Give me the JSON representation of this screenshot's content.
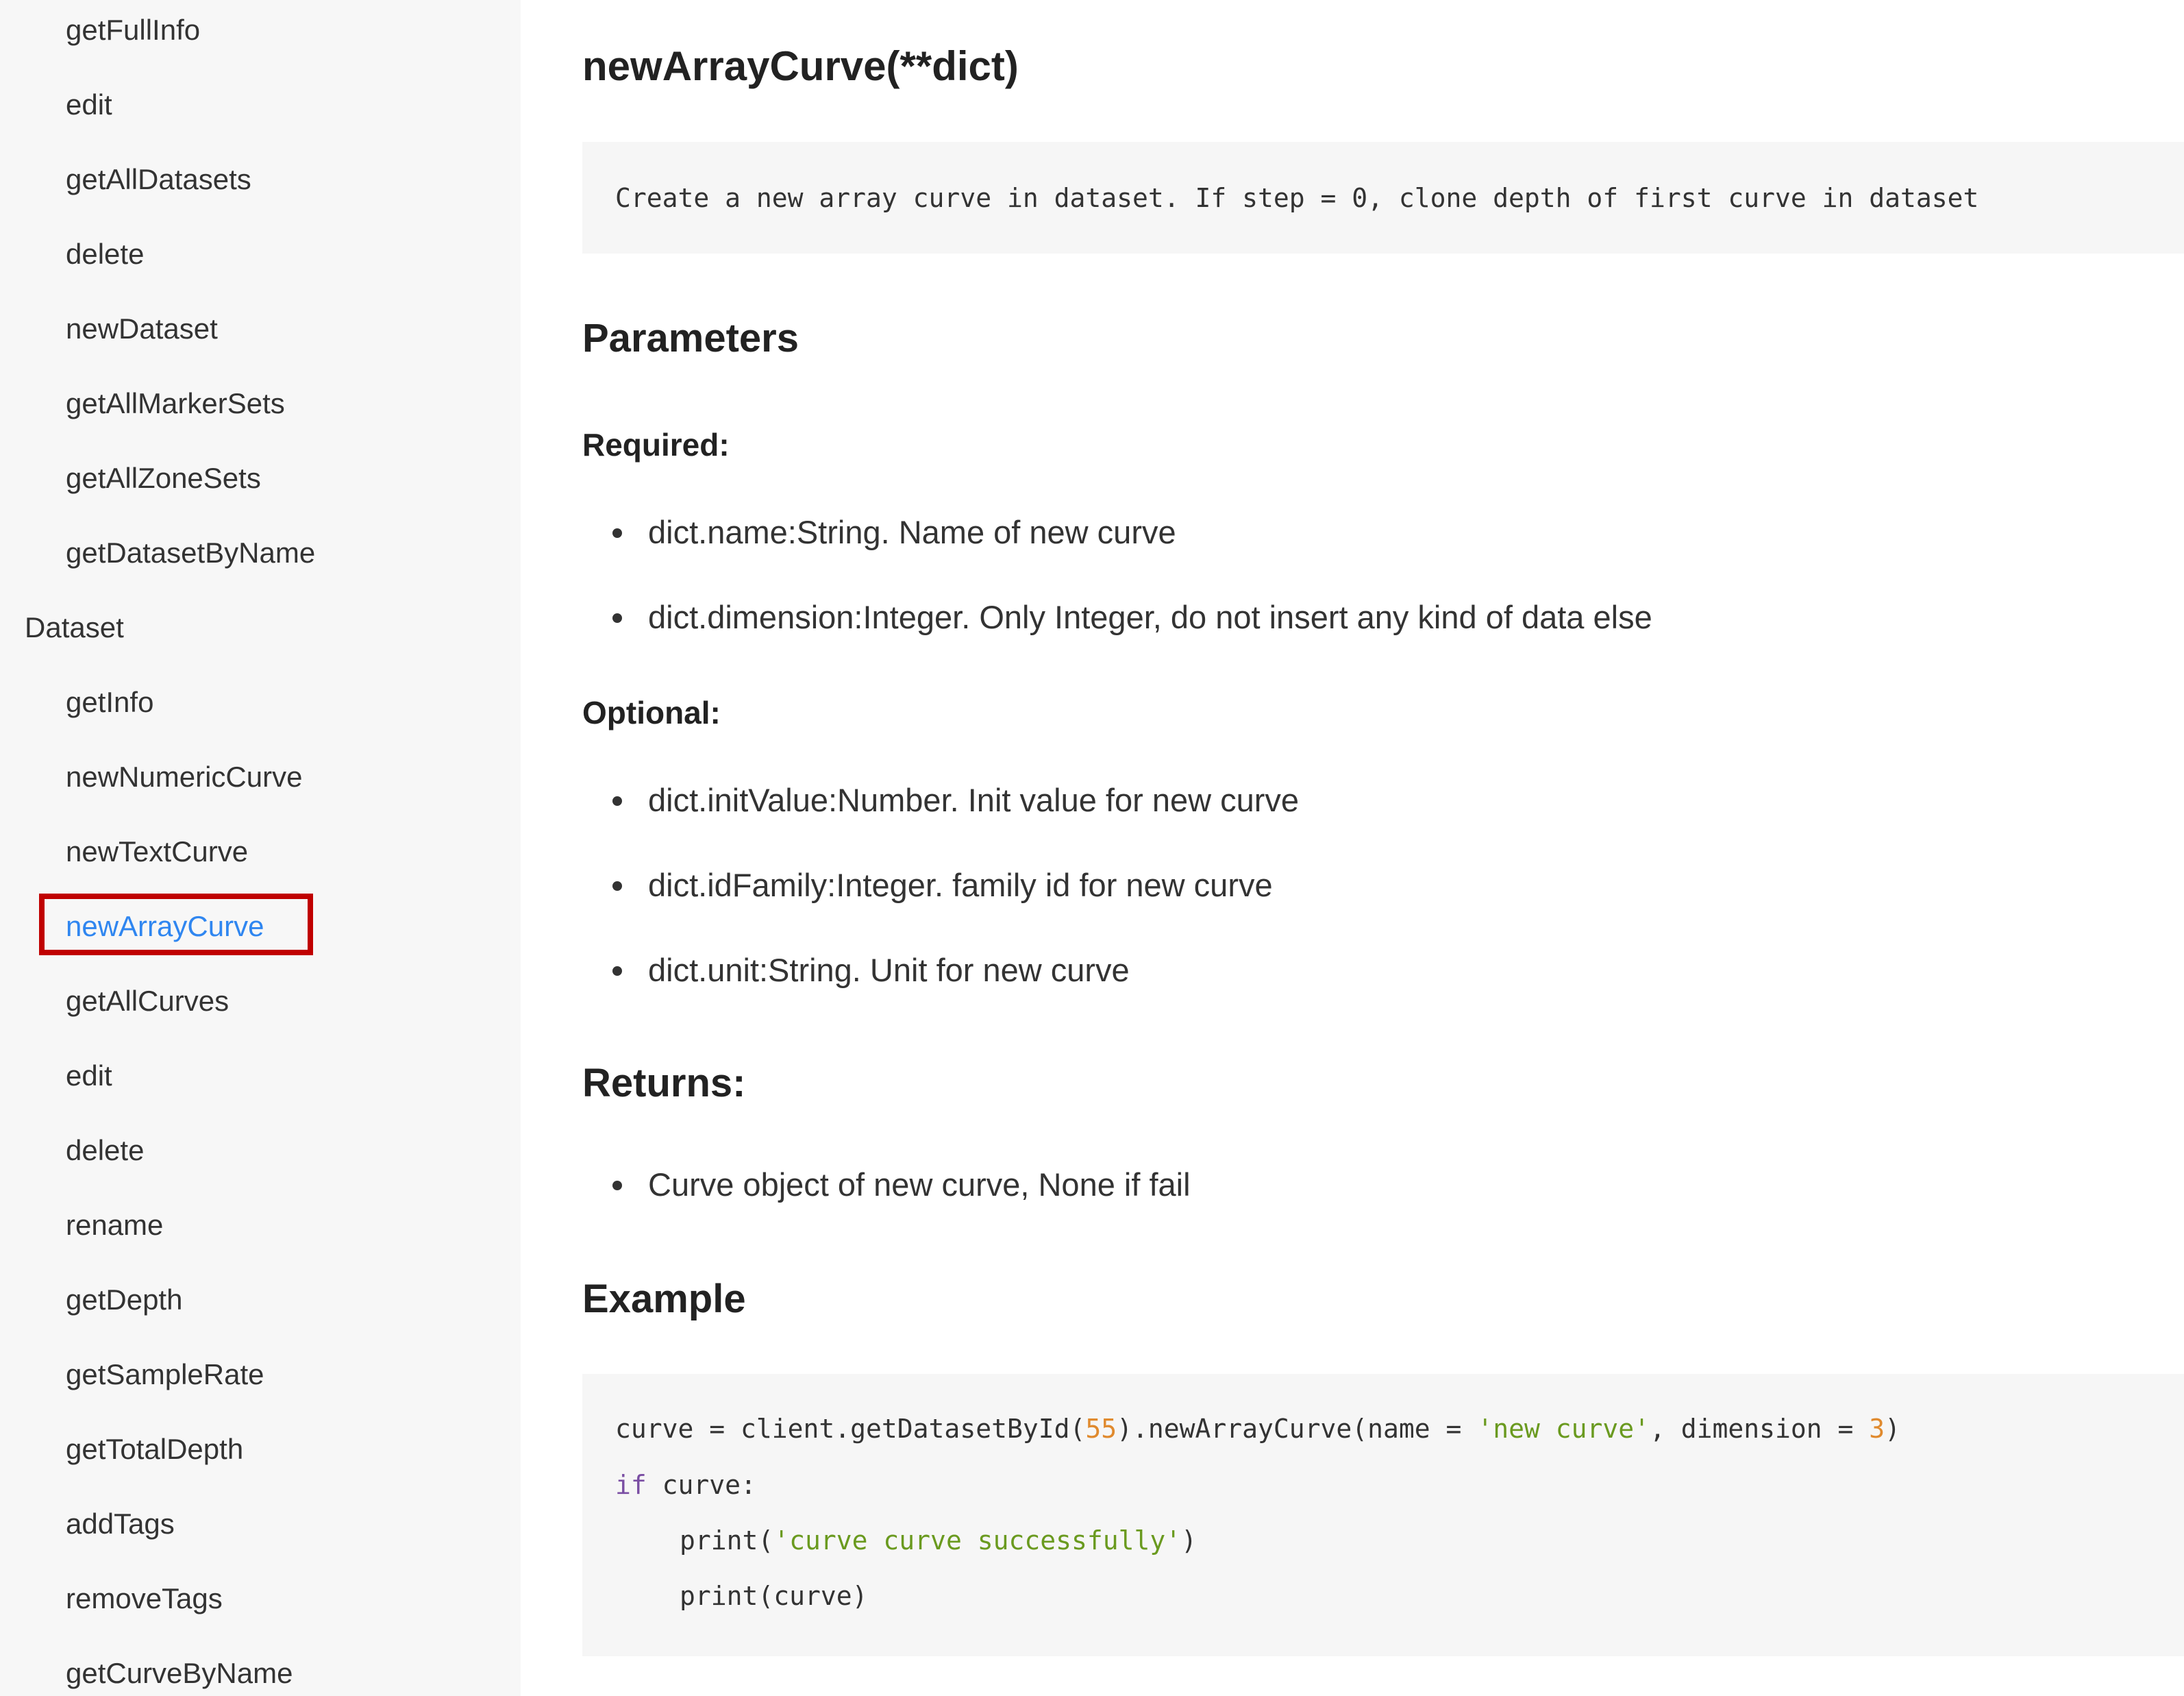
{
  "sidebar": {
    "items": [
      {
        "label": "getFullInfo"
      },
      {
        "label": "edit"
      },
      {
        "label": "getAllDatasets"
      },
      {
        "label": "delete"
      },
      {
        "label": "newDataset"
      },
      {
        "label": "getAllMarkerSets"
      },
      {
        "label": "getAllZoneSets"
      },
      {
        "label": "getDatasetByName"
      },
      {
        "label": "Dataset"
      },
      {
        "label": "getInfo"
      },
      {
        "label": "newNumericCurve"
      },
      {
        "label": "newTextCurve"
      },
      {
        "label": "newArrayCurve"
      },
      {
        "label": "getAllCurves"
      },
      {
        "label": "edit"
      },
      {
        "label": "delete"
      },
      {
        "label": "rename"
      },
      {
        "label": "getDepth"
      },
      {
        "label": "getSampleRate"
      },
      {
        "label": "getTotalDepth"
      },
      {
        "label": "addTags"
      },
      {
        "label": "removeTags"
      },
      {
        "label": "getCurveByName"
      }
    ],
    "active_item": "newArrayCurve",
    "colors": {
      "active": "#2f86f0",
      "highlight_border": "#c00000",
      "background": "#f7f7f7"
    }
  },
  "main": {
    "title": "newArrayCurve(**dict)",
    "description": "Create a new array curve in dataset. If step = 0, clone depth of first curve in dataset",
    "parameters_heading": "Parameters",
    "required_heading": "Required:",
    "required_items": [
      "dict.name:String. Name of new curve",
      "dict.dimension:Integer. Only Integer, do not insert any kind of data else"
    ],
    "optional_heading": "Optional:",
    "optional_items": [
      "dict.initValue:Number. Init value for new curve",
      "dict.idFamily:Integer. family id for new curve",
      "dict.unit:String. Unit for new curve"
    ],
    "returns_heading": "Returns:",
    "returns_items": [
      "Curve object of new curve, None if fail"
    ],
    "example_heading": "Example",
    "code": {
      "line1": {
        "p1": "curve = client.getDatasetById(",
        "num1": "55",
        "p2": ").newArrayCurve(name = ",
        "str1": "'new curve'",
        "p3": ", dimension = ",
        "num2": "3",
        "p4": ")"
      },
      "line2": {
        "kw": "if",
        "p1": " curve:"
      },
      "line3": {
        "p1": "print(",
        "str1": "'curve curve successfully'",
        "p2": ")"
      },
      "line4": {
        "p1": "print(curve)"
      },
      "colors": {
        "number": "#e08a2e",
        "string": "#6a9a1f",
        "keyword": "#7a4ea3",
        "background": "#f6f6f6"
      }
    }
  }
}
